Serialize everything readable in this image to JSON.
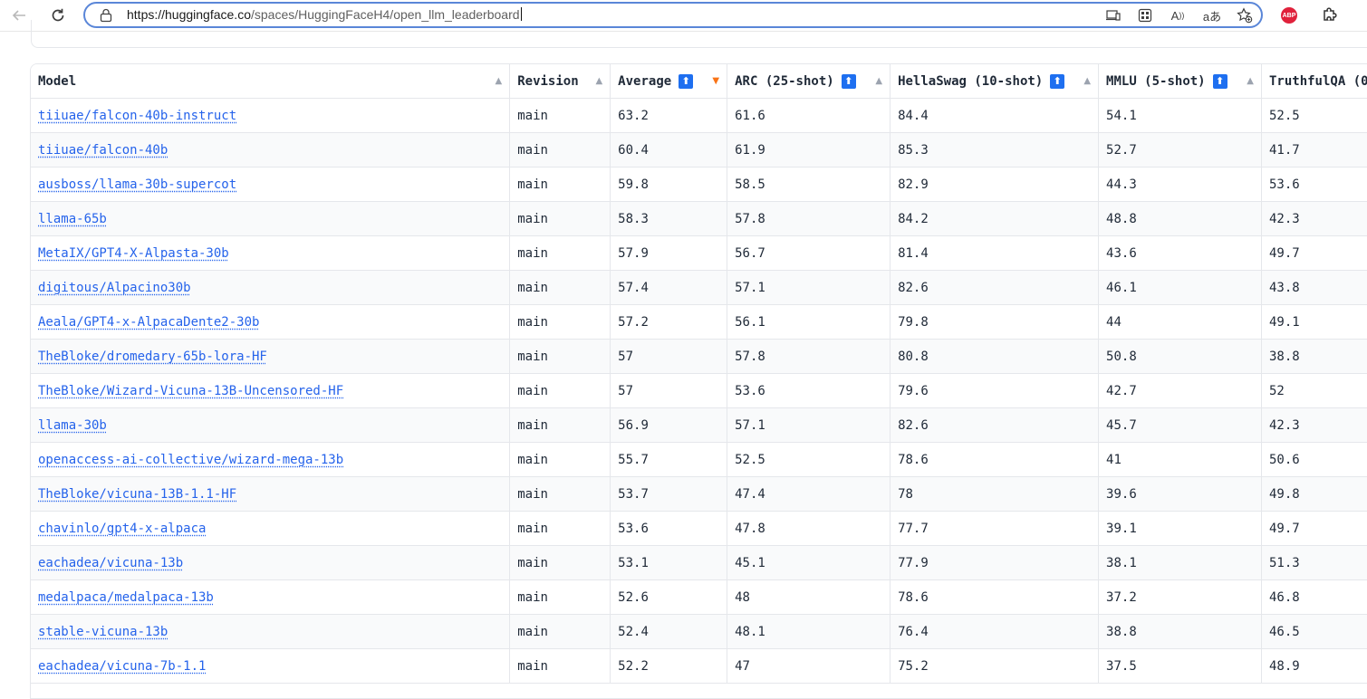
{
  "browser": {
    "url_host": "https://huggingface.co",
    "url_path": "/spaces/HuggingFaceH4/open_llm_leaderboard",
    "icons": [
      "back-icon",
      "refresh-icon",
      "lock-icon",
      "app-available-icon",
      "browser-essentials-icon",
      "read-aloud-icon",
      "translate-icon",
      "add-favorite-icon",
      "adblock-plus-icon",
      "extensions-icon"
    ],
    "read_aloud_glyph": "A",
    "translate_glyph": "aあ",
    "abp_label": "ABP"
  },
  "table": {
    "columns": [
      {
        "label": "Model",
        "badge": "",
        "sort": "▲"
      },
      {
        "label": "Revision",
        "badge": "",
        "sort": "▲"
      },
      {
        "label": "Average",
        "badge": "⬆",
        "sort": "▼"
      },
      {
        "label": "ARC (25-shot)",
        "badge": "⬆",
        "sort": "▲"
      },
      {
        "label": "HellaSwag (10-shot)",
        "badge": "⬆",
        "sort": "▲"
      },
      {
        "label": "MMLU (5-shot)",
        "badge": "⬆",
        "sort": "▲"
      },
      {
        "label": "TruthfulQA (0",
        "badge": "",
        "sort": ""
      }
    ],
    "rows": [
      [
        "tiiuae/falcon-40b-instruct",
        "main",
        "63.2",
        "61.6",
        "84.4",
        "54.1",
        "52.5"
      ],
      [
        "tiiuae/falcon-40b",
        "main",
        "60.4",
        "61.9",
        "85.3",
        "52.7",
        "41.7"
      ],
      [
        "ausboss/llama-30b-supercot",
        "main",
        "59.8",
        "58.5",
        "82.9",
        "44.3",
        "53.6"
      ],
      [
        "llama-65b",
        "main",
        "58.3",
        "57.8",
        "84.2",
        "48.8",
        "42.3"
      ],
      [
        "MetaIX/GPT4-X-Alpasta-30b",
        "main",
        "57.9",
        "56.7",
        "81.4",
        "43.6",
        "49.7"
      ],
      [
        "digitous/Alpacino30b",
        "main",
        "57.4",
        "57.1",
        "82.6",
        "46.1",
        "43.8"
      ],
      [
        "Aeala/GPT4-x-AlpacaDente2-30b",
        "main",
        "57.2",
        "56.1",
        "79.8",
        "44",
        "49.1"
      ],
      [
        "TheBloke/dromedary-65b-lora-HF",
        "main",
        "57",
        "57.8",
        "80.8",
        "50.8",
        "38.8"
      ],
      [
        "TheBloke/Wizard-Vicuna-13B-Uncensored-HF",
        "main",
        "57",
        "53.6",
        "79.6",
        "42.7",
        "52"
      ],
      [
        "llama-30b",
        "main",
        "56.9",
        "57.1",
        "82.6",
        "45.7",
        "42.3"
      ],
      [
        "openaccess-ai-collective/wizard-mega-13b",
        "main",
        "55.7",
        "52.5",
        "78.6",
        "41",
        "50.6"
      ],
      [
        "TheBloke/vicuna-13B-1.1-HF",
        "main",
        "53.7",
        "47.4",
        "78",
        "39.6",
        "49.8"
      ],
      [
        "chavinlo/gpt4-x-alpaca",
        "main",
        "53.6",
        "47.8",
        "77.7",
        "39.1",
        "49.7"
      ],
      [
        "eachadea/vicuna-13b",
        "main",
        "53.1",
        "45.1",
        "77.9",
        "38.1",
        "51.3"
      ],
      [
        "medalpaca/medalpaca-13b",
        "main",
        "52.6",
        "48",
        "78.6",
        "37.2",
        "46.8"
      ],
      [
        "stable-vicuna-13b",
        "main",
        "52.4",
        "48.1",
        "76.4",
        "38.8",
        "46.5"
      ],
      [
        "eachadea/vicuna-7b-1.1",
        "main",
        "52.2",
        "47",
        "75.2",
        "37.5",
        "48.9"
      ]
    ]
  },
  "colors": {
    "link": "#2563eb",
    "badge": "#1e6ff0",
    "active_sort": "#f97316",
    "address_focus": "#5a86d8",
    "abp": "#e0213b"
  }
}
